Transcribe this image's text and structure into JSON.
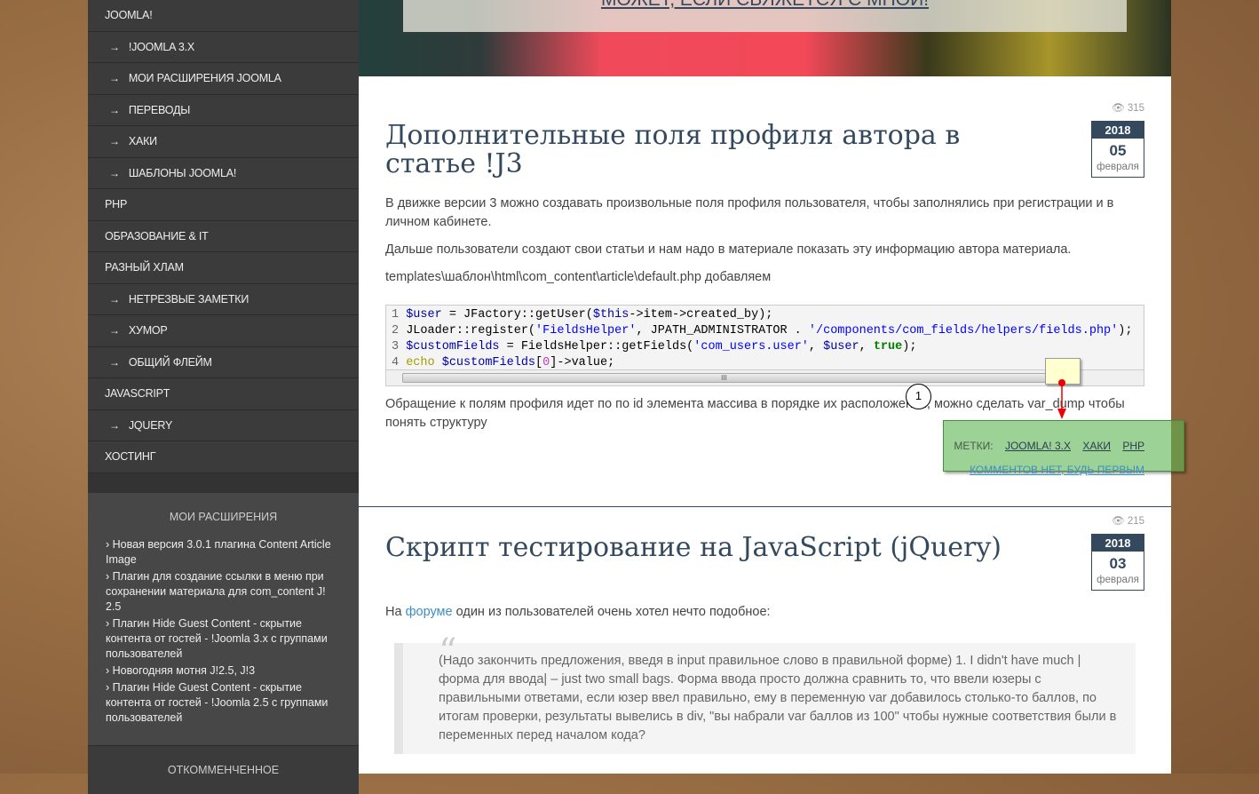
{
  "sidebar": {
    "menu": [
      {
        "label": "JOOMLA!",
        "sub": false
      },
      {
        "label": "!JOOMLA 3.X",
        "sub": true
      },
      {
        "label": "МОИ РАСШИРЕНИЯ JOOMLA",
        "sub": true
      },
      {
        "label": "ПЕРЕВОДЫ",
        "sub": true
      },
      {
        "label": "ХАКИ",
        "sub": true
      },
      {
        "label": "ШАБЛОНЫ JOOMLA!",
        "sub": true
      },
      {
        "label": "PHP",
        "sub": false
      },
      {
        "label": "ОБРАЗОВАНИЕ & IT",
        "sub": false
      },
      {
        "label": "РАЗНЫЙ ХЛАМ",
        "sub": false
      },
      {
        "label": "НЕТРЕЗВЫЕ ЗАМЕТКИ",
        "sub": true
      },
      {
        "label": "ХУМОР",
        "sub": true
      },
      {
        "label": "ОБЩИЙ ФЛЕЙМ",
        "sub": true
      },
      {
        "label": "JAVASCRIPT",
        "sub": false
      },
      {
        "label": "JQUERY",
        "sub": true
      },
      {
        "label": "ХОСТИНГ",
        "sub": false
      }
    ],
    "arrow": "→",
    "widget1": {
      "title": "МОИ РАСШИРЕНИЯ",
      "items": [
        "Новая версия 3.0.1 плагина Content Article Image",
        "Плагин для создание ссылки в меню при сохранении материала для com_content J! 2.5",
        "Плагин Hide Guest Content - скрытие контента от гостей - !Joomla 3.x с группами пользователей",
        "Новогодняя мотня J!2.5, J!3",
        "Плагин Hide Guest Content - скрытие контента от гостей - !Joomla 2.5 с группами пользователей"
      ]
    },
    "widget2": {
      "title": "ОТКОММЕНЧЕННОЕ"
    }
  },
  "banner": {
    "caption": "МОЖЕТ, ЕСЛИ СВЯЖЕТСЯ С МНОЙ!"
  },
  "article1": {
    "title": "Дополнительные поля профиля автора в статье !J3",
    "views": "315",
    "year": "2018",
    "day": "05",
    "month": "февраля",
    "p1": "В движке версии 3 можно создавать произвольные поля профиля пользователя, чтобы заполнялись при регистрации и в личном кабинете.",
    "p2": "Дальше пользователи создают свои статьи и нам надо в материале показать эту информацию автора материала.",
    "p3": "templates\\шаблон\\html\\com_content\\article\\default.php добавляем",
    "p4": "Обращение к полям профиля идет по по id элемента массива в порядке их расположения, можно сделать var_dump чтобы понять структуру",
    "tags_label": "МЕТКИ:",
    "tags": [
      "JOOMLA! 3.X",
      "ХАКИ",
      "PHP"
    ],
    "comments": "КОММЕНТОВ НЕТ, БУДЬ ПЕРВЫМ",
    "scroll_grip": "III"
  },
  "annotation": {
    "number": "1"
  },
  "article2": {
    "title": "Скрипт тестирование на JavaScript (jQuery)",
    "views": "215",
    "year": "2018",
    "day": "03",
    "month": "февраля",
    "p1_pre": "На ",
    "p1_link": "форуме",
    "p1_post": " один из пользователей очень хотел нечто подобное:",
    "quote_mark": "“",
    "quote": "(Надо закончить предложения, введя в input правильное слово в правильной форме) 1. I didn't have much |форма для ввода| – just two small bags. Форма ввода просто должна сравнить то, что ввели юзеры с правильными ответами, если юзер ввел правильно, ему в переменную var добавилось столько-то баллов, по итогам проверки, результаты вывелись в div, \"вы набрали var баллов из 100\" чтобы нужные соответствия были в переменных перед началом кода?"
  }
}
